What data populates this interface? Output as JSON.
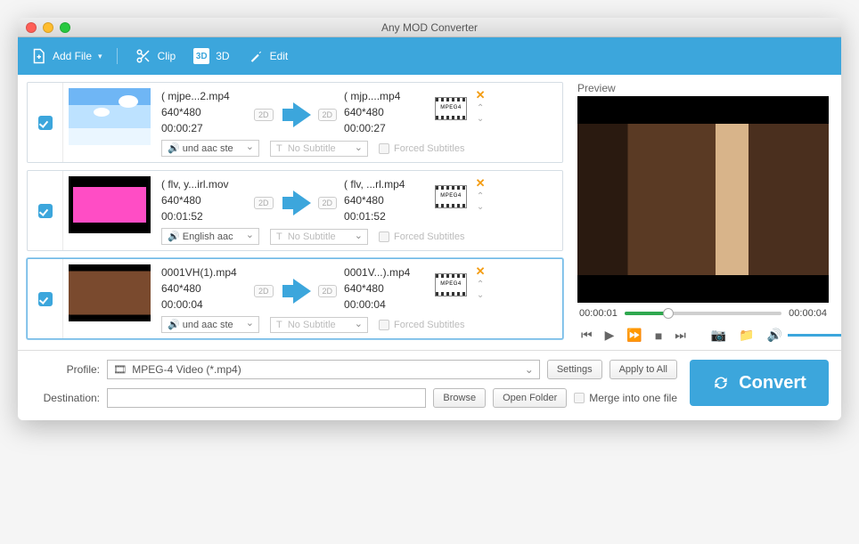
{
  "window": {
    "title": "Any MOD Converter"
  },
  "toolbar": {
    "addFile": "Add File",
    "clip": "Clip",
    "threeD": "3D",
    "edit": "Edit"
  },
  "files": [
    {
      "checked": true,
      "srcName": "( mjpe...2.mp4",
      "srcRes": "640*480",
      "srcDur": "00:00:27",
      "dstName": "( mjp....mp4",
      "dstRes": "640*480",
      "dstDur": "00:00:27",
      "audio": "und aac ste",
      "subtitle": "No Subtitle",
      "forced": "Forced Subtitles",
      "badge": "MPEG4"
    },
    {
      "checked": true,
      "srcName": "( flv, y...irl.mov",
      "srcRes": "640*480",
      "srcDur": "00:01:52",
      "dstName": "( flv, ...rl.mp4",
      "dstRes": "640*480",
      "dstDur": "00:01:52",
      "audio": "English aac",
      "subtitle": "No Subtitle",
      "forced": "Forced Subtitles",
      "badge": "MPEG4"
    },
    {
      "checked": true,
      "srcName": "0001VH(1).mp4",
      "srcRes": "640*480",
      "srcDur": "00:00:04",
      "dstName": "0001V...).mp4",
      "dstRes": "640*480",
      "dstDur": "00:00:04",
      "audio": "und aac ste",
      "subtitle": "No Subtitle",
      "forced": "Forced Subtitles",
      "badge": "MPEG4"
    }
  ],
  "preview": {
    "label": "Preview",
    "curTime": "00:00:01",
    "totTime": "00:00:04",
    "progressPct": 28
  },
  "bottom": {
    "profileLabel": "Profile:",
    "profileValue": "MPEG-4 Video (*.mp4)",
    "settings": "Settings",
    "applyAll": "Apply to All",
    "destLabel": "Destination:",
    "destValue": "",
    "browse": "Browse",
    "openFolder": "Open Folder",
    "merge": "Merge into one file",
    "convert": "Convert"
  },
  "badges": {
    "twoD": "2D"
  }
}
